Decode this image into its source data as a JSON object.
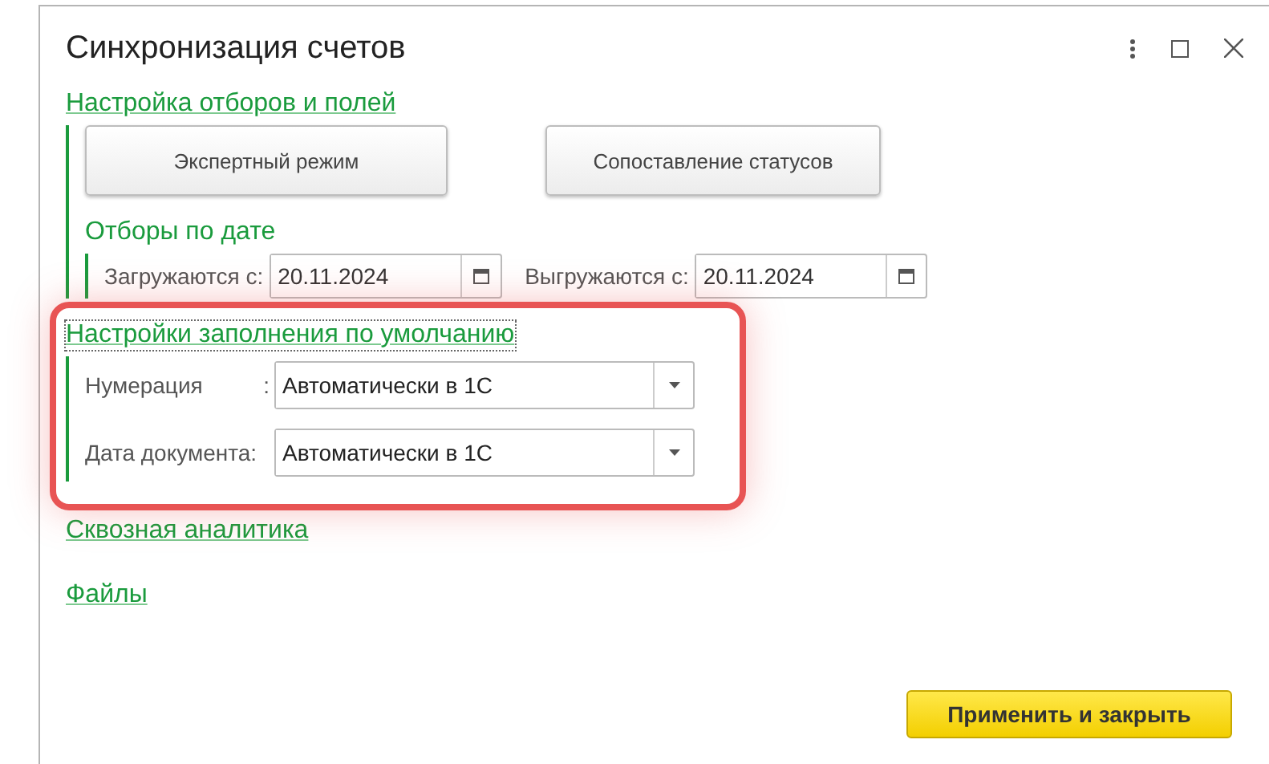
{
  "window": {
    "title": "Синхронизация счетов"
  },
  "sections": [
    {
      "kind": "buttons",
      "link": "Настройка отборов и полей",
      "focused": false,
      "buttons": [
        "Экспертный режим",
        "Сопоставление статусов"
      ],
      "subgroup": {
        "title": "Отборы по дате",
        "fields": [
          {
            "label": "Загружаются с:",
            "value": "20.11.2024"
          },
          {
            "label": "Выгружаются с:",
            "value": "20.11.2024"
          }
        ]
      }
    },
    {
      "kind": "selects",
      "link": "Настройки заполнения по умолчанию",
      "focused": true,
      "highlighted": true,
      "rows": [
        {
          "label": "Нумерация",
          "colon": ":",
          "value": "Автоматически в 1С"
        },
        {
          "label": "Дата документа:",
          "value": "Автоматически в 1С"
        }
      ]
    },
    {
      "kind": "link",
      "link": "Сквозная аналитика",
      "focused": false
    },
    {
      "kind": "link",
      "link": "Файлы",
      "focused": false
    }
  ],
  "footer": {
    "button": "Применить и закрыть"
  }
}
